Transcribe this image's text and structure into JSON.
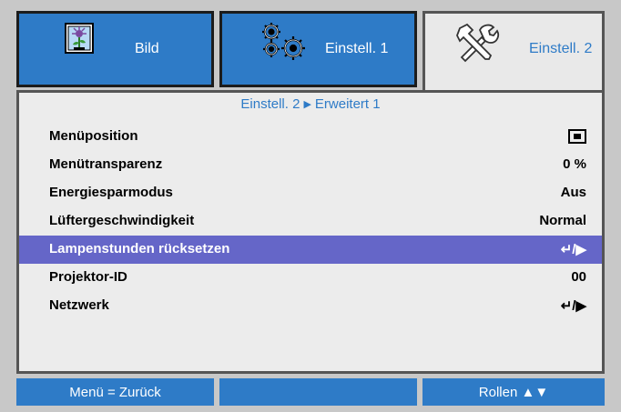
{
  "tabs": [
    {
      "label": "Bild",
      "icon": "picture-icon",
      "active": false
    },
    {
      "label": "Einstell. 1",
      "icon": "gears-icon",
      "active": false
    },
    {
      "label": "Einstell. 2",
      "icon": "tools-icon",
      "active": true
    }
  ],
  "breadcrumb": {
    "parent": "Einstell. 2",
    "current": "Erweitert 1"
  },
  "rows": [
    {
      "label": "Menüposition",
      "value": ""
    },
    {
      "label": "Menütransparenz",
      "value": "0 %"
    },
    {
      "label": "Energiesparmodus",
      "value": "Aus"
    },
    {
      "label": "Lüftergeschwindigkeit",
      "value": "Normal"
    },
    {
      "label": "Lampenstunden rücksetzen",
      "value": "↵/▶"
    },
    {
      "label": "Projektor-ID",
      "value": "00"
    },
    {
      "label": "Netzwerk",
      "value": "↵/▶"
    }
  ],
  "footer": {
    "back": "Menü = Zurück",
    "middle": "",
    "scroll": "Rollen ▲▼"
  },
  "colors": {
    "accent": "#2e7bc7",
    "selection": "#6566c8",
    "frame": "#c8c8c8",
    "panel": "#ececec"
  }
}
